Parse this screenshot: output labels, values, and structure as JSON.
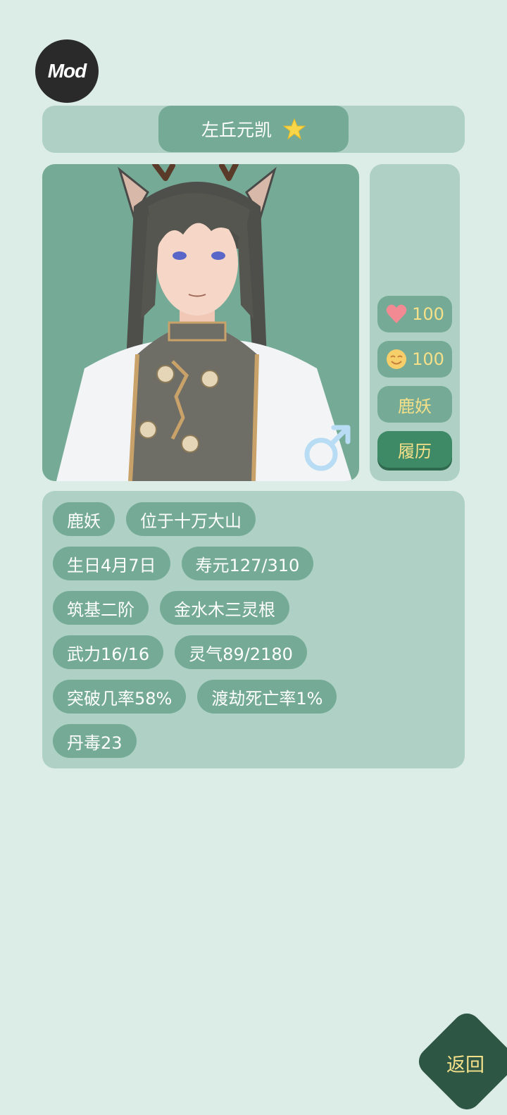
{
  "mod_badge": "Mod",
  "character": {
    "name": "左丘元凯",
    "favorite_icon": "star-icon",
    "gender_icon": "male-symbol-icon"
  },
  "side_panel": {
    "affection": "100",
    "affection_icon": "heart-icon",
    "mood": "100",
    "mood_icon": "smiley-icon",
    "race": "鹿妖",
    "resume_button": "履历"
  },
  "attributes": [
    [
      "鹿妖",
      "位于十万大山"
    ],
    [
      "生日4月7日",
      "寿元127/310"
    ],
    [
      "筑基二阶",
      "金水木三灵根"
    ],
    [
      "武力16/16",
      "灵气89/2180"
    ],
    [
      "突破几率58%",
      "渡劫死亡率1%"
    ],
    [
      "丹毒23"
    ]
  ],
  "back_button": "返回",
  "colors": {
    "background": "#dcece6",
    "panel": "#aed0c5",
    "chip": "#75ab96",
    "accent_text": "#f5e08a",
    "button_dark": "#2e5644"
  }
}
